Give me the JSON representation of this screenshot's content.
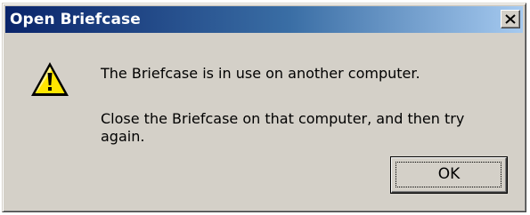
{
  "window": {
    "title": "Open Briefcase",
    "close_glyph": "✕"
  },
  "message": {
    "line1": "The Briefcase is in use on another computer.",
    "line2": "Close the Briefcase on that computer, and then try again."
  },
  "buttons": {
    "ok_label": "OK"
  },
  "icons": {
    "status": "warning-icon"
  },
  "colors": {
    "titlebar_start": "#0a246a",
    "titlebar_end": "#a6caf0",
    "dialog_face": "#d4d0c8",
    "warning_fill": "#ffe600"
  }
}
